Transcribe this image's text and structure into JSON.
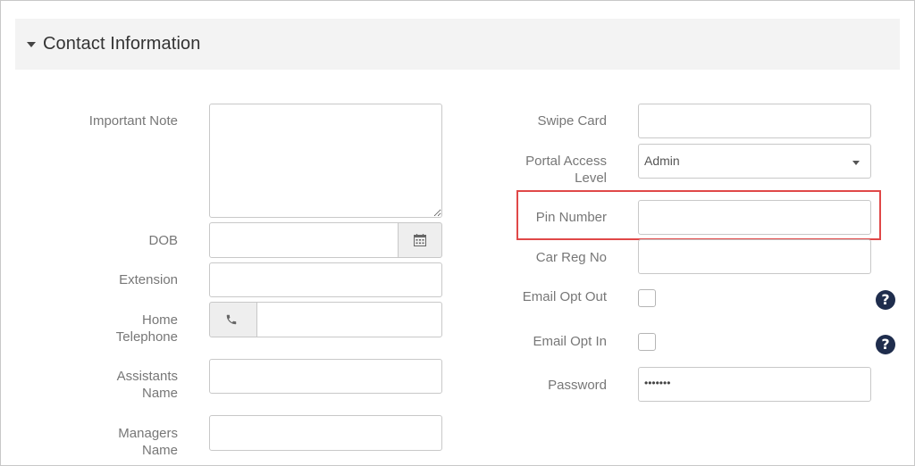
{
  "section": {
    "title": "Contact Information"
  },
  "left": {
    "important_note": {
      "label": "Important Note"
    },
    "dob": {
      "label": "DOB"
    },
    "extension": {
      "label": "Extension"
    },
    "home_telephone": {
      "label_line1": "Home",
      "label_line2": "Telephone"
    },
    "assistants_name": {
      "label_line1": "Assistants",
      "label_line2": "Name"
    },
    "managers_name": {
      "label_line1": "Managers",
      "label_line2": "Name"
    }
  },
  "right": {
    "swipe_card": {
      "label": "Swipe Card"
    },
    "portal_access_level": {
      "label_line1": "Portal Access",
      "label_line2": "Level",
      "value": "Admin"
    },
    "pin_number": {
      "label": "Pin Number"
    },
    "car_reg_no": {
      "label": "Car Reg No"
    },
    "email_opt_out": {
      "label": "Email Opt Out",
      "help": "?"
    },
    "email_opt_in": {
      "label": "Email Opt In",
      "help": "?"
    },
    "password": {
      "label": "Password",
      "value": "•••••••"
    }
  },
  "colors": {
    "highlight": "#e04848",
    "help_icon": "#1f2d4d",
    "header_bg": "#f3f3f3"
  },
  "icons": {
    "calendar": "calendar-icon",
    "phone": "phone-icon",
    "caret": "caret-down-icon"
  }
}
